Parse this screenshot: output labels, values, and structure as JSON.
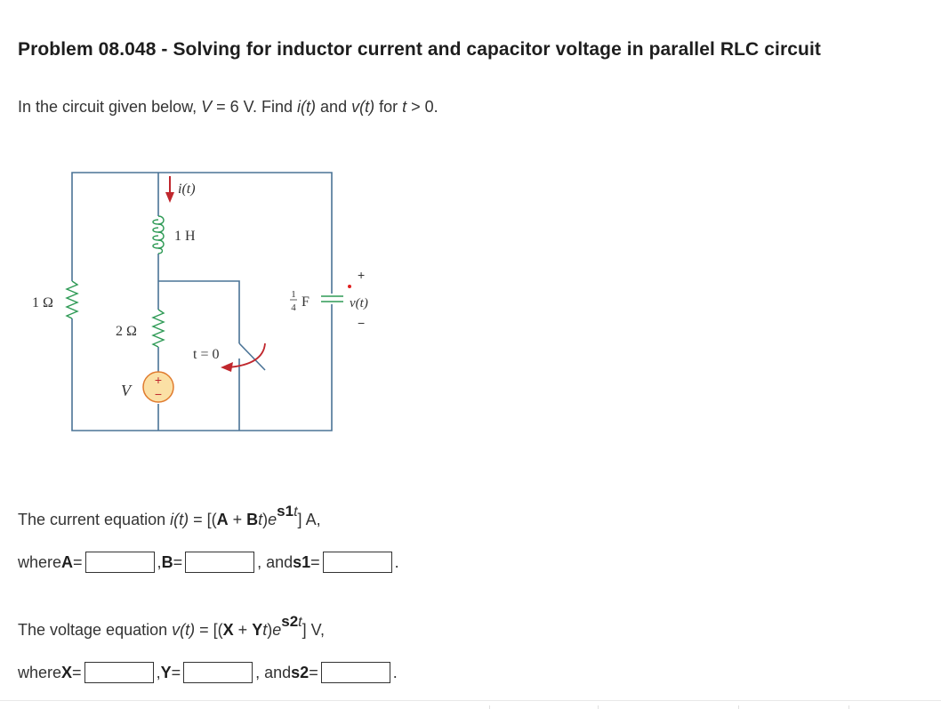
{
  "problem": {
    "title": "Problem 08.048 - Solving for inductor current and capacitor voltage in parallel RLC circuit",
    "intro_parts": {
      "p1": "In the circuit given below, ",
      "V": "V",
      "p2": " = 6 V. Find ",
      "i": "i",
      "it_t": "(t)",
      "p3": " and ",
      "v": "v",
      "vt_t": "(t)",
      "p4": " for ",
      "t": "t",
      "p5": " > 0."
    }
  },
  "circuit": {
    "labels": {
      "current": "i(t)",
      "inductor": "1 H",
      "r1": "1 Ω",
      "r2": "2 Ω",
      "source": "V",
      "switch": "t = 0",
      "cap_num": "1",
      "cap_den": "4",
      "cap_unit": "F",
      "voltage": "v(t)",
      "plus": "+",
      "minus": "−",
      "src_plus": "+",
      "src_minus": "−"
    },
    "colors": {
      "wire": "#4a7396",
      "component": "#2e9a55",
      "arrow": "#c0272d",
      "source_fill": "#fbe0a5",
      "source_stroke": "#e07b2e"
    }
  },
  "current_eq": {
    "lead": "The current equation ",
    "fn": "i",
    "arg": "(t)",
    "eq": " = [(",
    "A": "A",
    "plus": " + ",
    "B": "B",
    "t": "t",
    "close": ")",
    "e": "e",
    "exp": "s1",
    "exp_t": "t",
    "bracket": "]",
    "unit": " A,"
  },
  "current_row": {
    "where": "where ",
    "A_label": "A",
    "eq": " =",
    "sep1": ", ",
    "B_label": "B",
    "sep2": ", and ",
    "s1_label": "s1",
    "end": ".",
    "A_value": "",
    "B_value": "",
    "s1_value": ""
  },
  "voltage_eq": {
    "lead": "The voltage equation ",
    "fn": "v",
    "arg": "(t)",
    "eq": " = [(",
    "X": "X",
    "plus": " + ",
    "Y": "Y",
    "t": "t",
    "close": ")",
    "e": "e",
    "exp": "s2",
    "exp_t": "t",
    "bracket": "]",
    "unit": " V,"
  },
  "voltage_row": {
    "where": "where ",
    "X_label": "X",
    "eq": " =",
    "sep1": ", ",
    "Y_label": "Y",
    "sep2": ", and ",
    "s2_label": "s2",
    "end": ".",
    "X_value": "",
    "Y_value": "",
    "s2_value": ""
  }
}
